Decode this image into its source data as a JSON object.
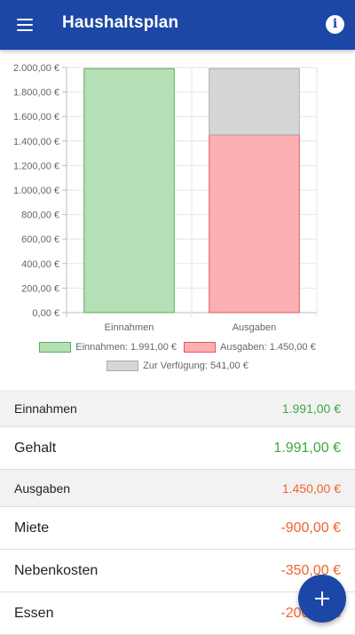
{
  "appbar": {
    "title": "Haushaltsplan",
    "menu_icon": "menu-icon",
    "info_icon": "info-icon"
  },
  "chart_data": {
    "type": "bar",
    "stacked": true,
    "categories": [
      "Einnahmen",
      "Ausgaben"
    ],
    "series": [
      {
        "name": "Einnahmen: 1.991,00 €",
        "values": [
          1991,
          0
        ],
        "color": "#b5e0b5",
        "border": "#5cab5c"
      },
      {
        "name": "Ausgaben: 1.450,00 €",
        "values": [
          0,
          1450
        ],
        "color": "#fcb0b3",
        "border": "#e25559"
      },
      {
        "name": "Zur Verfügung: 541,00 €",
        "values": [
          0,
          541
        ],
        "color": "#d6d6d6",
        "border": "#aaaaaa"
      }
    ],
    "ylim": [
      0,
      2000
    ],
    "yticks": [
      "0,00 €",
      "200,00 €",
      "400,00 €",
      "600,00 €",
      "800,00 €",
      "1.000,00 €",
      "1.200,00 €",
      "1.400,00 €",
      "1.600,00 €",
      "1.800,00 €",
      "2.000,00 €"
    ],
    "grid": true,
    "legend_position": "bottom"
  },
  "sections": {
    "income": {
      "label": "Einnahmen",
      "total": "1.991,00 €",
      "items": [
        {
          "label": "Gehalt",
          "amount": "1.991,00 €"
        }
      ]
    },
    "expenses": {
      "label": "Ausgaben",
      "total": "1.450,00 €",
      "items": [
        {
          "label": "Miete",
          "amount": "-900,00 €"
        },
        {
          "label": "Nebenkosten",
          "amount": "-350,00 €"
        },
        {
          "label": "Essen",
          "amount": "-200,00 €"
        }
      ]
    }
  },
  "fab": {
    "icon": "plus-icon"
  },
  "colors": {
    "primary": "#1c47a6",
    "positive": "#3da83d",
    "negative": "#f2622d"
  }
}
